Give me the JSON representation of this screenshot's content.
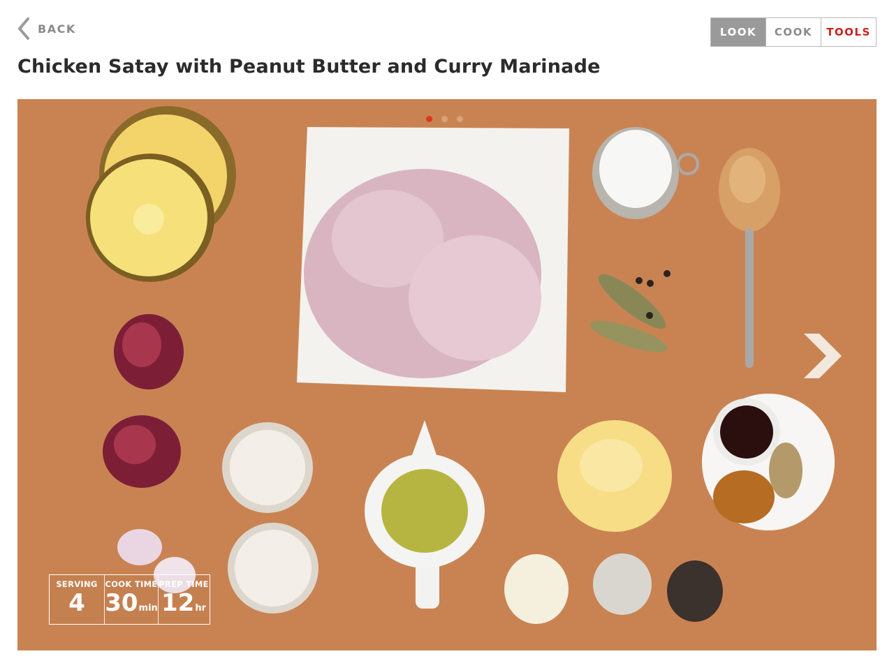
{
  "nav": {
    "back_label": "BACK"
  },
  "tabs": [
    {
      "label": "LOOK",
      "active": true
    },
    {
      "label": "COOK",
      "active": false
    },
    {
      "label": "TOOLS",
      "active": false
    }
  ],
  "recipe": {
    "title": "Chicken Satay with Peanut Butter and Curry Marinade"
  },
  "carousel": {
    "slide_count": 3,
    "active_slide": 1
  },
  "stats": {
    "serving": {
      "label": "SERVING",
      "value": "4",
      "unit": ""
    },
    "cook_time": {
      "label": "COOK TIME",
      "value": "30",
      "unit": "min"
    },
    "prep_time": {
      "label": "PREP TIME",
      "value": "12",
      "unit": "hr"
    }
  },
  "colors": {
    "accent_red": "#cc1f1f",
    "active_tab_bg": "#9a9a9a",
    "hero_background": "#c98352"
  }
}
